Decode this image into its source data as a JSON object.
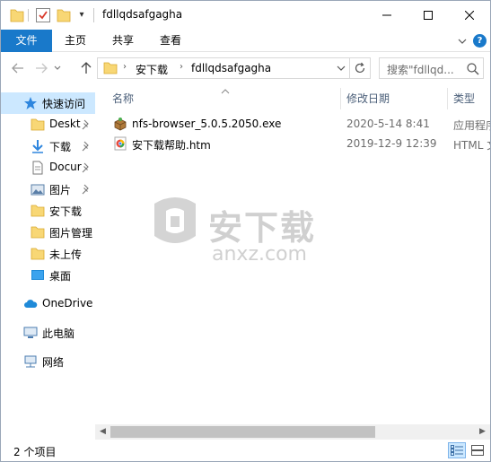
{
  "window": {
    "title": "fdllqdsafgagha",
    "quick_access_dropdown": "▾"
  },
  "ribbon": {
    "tabs": [
      {
        "label": "文件"
      },
      {
        "label": "主页"
      },
      {
        "label": "共享"
      },
      {
        "label": "查看"
      }
    ],
    "help": "?"
  },
  "address": {
    "crumbs": [
      "安下载",
      "fdllqdsafgagha"
    ],
    "separator": "›"
  },
  "search": {
    "placeholder": "搜索\"fdllqd..."
  },
  "sidebar": {
    "items": [
      {
        "label": "快速访问",
        "icon": "star-icon"
      },
      {
        "label": "Deskt",
        "icon": "folder-icon",
        "pinned": true
      },
      {
        "label": "下载",
        "icon": "download-icon",
        "pinned": true
      },
      {
        "label": "Docur",
        "icon": "document-icon",
        "pinned": true
      },
      {
        "label": "图片",
        "icon": "pictures-icon",
        "pinned": true
      },
      {
        "label": "安下载",
        "icon": "folder-icon"
      },
      {
        "label": "图片管理",
        "icon": "folder-icon"
      },
      {
        "label": "未上传",
        "icon": "folder-icon"
      },
      {
        "label": "桌面",
        "icon": "desktop-icon"
      },
      {
        "label": "OneDrive",
        "icon": "cloud-icon"
      },
      {
        "label": "此电脑",
        "icon": "computer-icon"
      },
      {
        "label": "网络",
        "icon": "network-icon"
      }
    ]
  },
  "columns": {
    "name": "名称",
    "date": "修改日期",
    "type": "类型"
  },
  "files": [
    {
      "name": "nfs-browser_5.0.5.2050.exe",
      "date": "2020-5-14 8:41",
      "type": "应用程序",
      "icon": "installer-icon"
    },
    {
      "name": "安下载帮助.htm",
      "date": "2019-12-9 12:39",
      "type": "HTML 文",
      "icon": "html-file-icon"
    }
  ],
  "watermark": {
    "text": "安下载",
    "url": "anxz.com"
  },
  "scrollbar": {
    "left_arrow": "◀",
    "right_arrow": "▶"
  },
  "status": {
    "item_count": "2 个项目"
  },
  "colors": {
    "accent": "#1979ca",
    "selection": "#cce8ff",
    "header_text": "#4c607a",
    "folder": "#f8d775"
  }
}
